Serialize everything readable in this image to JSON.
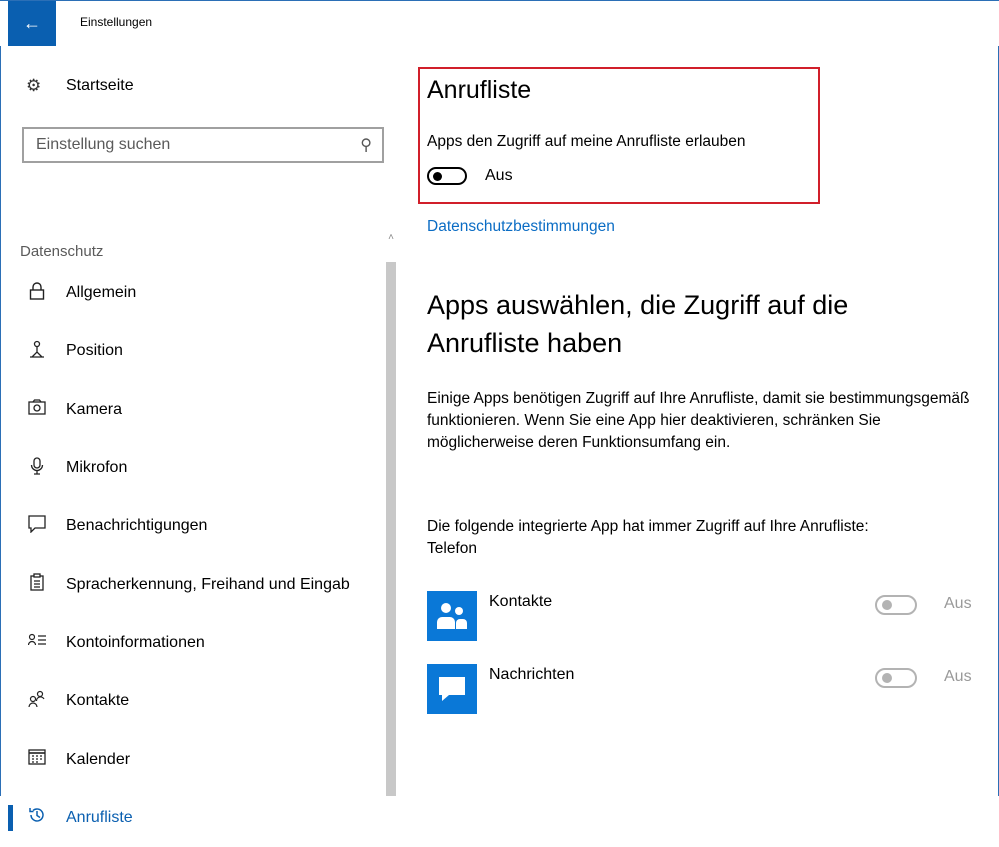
{
  "window": {
    "title": "Einstellungen"
  },
  "sidebar": {
    "home_label": "Startseite",
    "search_placeholder": "Einstellung suchen",
    "section_label": "Datenschutz",
    "items": [
      {
        "label": "Allgemein",
        "icon": "lock-icon"
      },
      {
        "label": "Position",
        "icon": "location-person-icon"
      },
      {
        "label": "Kamera",
        "icon": "camera-icon"
      },
      {
        "label": "Mikrofon",
        "icon": "microphone-icon"
      },
      {
        "label": "Benachrichtigungen",
        "icon": "message-icon"
      },
      {
        "label": "Spracherkennung, Freihand und Eingab",
        "icon": "clipboard-icon"
      },
      {
        "label": "Kontoinformationen",
        "icon": "account-info-icon"
      },
      {
        "label": "Kontakte",
        "icon": "contacts-icon"
      },
      {
        "label": "Kalender",
        "icon": "calendar-icon"
      },
      {
        "label": "Anrufliste",
        "icon": "history-icon",
        "active": true
      }
    ]
  },
  "main": {
    "title": "Anrufliste",
    "allow_label": "Apps den Zugriff auf meine Anrufliste erlauben",
    "allow_toggle_state": "Aus",
    "privacy_link": "Datenschutzbestimmungen",
    "choose_heading": "Apps auswählen, die Zugriff auf die Anrufliste haben",
    "choose_desc": "Einige Apps benötigen Zugriff auf Ihre Anrufliste, damit sie bestimmungsgemäß funktionieren. Wenn Sie eine App hier deaktivieren, schränken Sie möglicherweise deren Funktionsumfang ein.",
    "builtin_note_line1": "Die folgende integrierte App hat immer Zugriff auf Ihre Anrufliste:",
    "builtin_note_line2": "Telefon",
    "apps": [
      {
        "name": "Kontakte",
        "state": "Aus",
        "icon": "people-icon"
      },
      {
        "name": "Nachrichten",
        "state": "Aus",
        "icon": "chat-bubble-icon"
      }
    ]
  },
  "colors": {
    "accent": "#0a5fb0",
    "highlight": "#d11f2a",
    "app_tile": "#0a78d7"
  }
}
